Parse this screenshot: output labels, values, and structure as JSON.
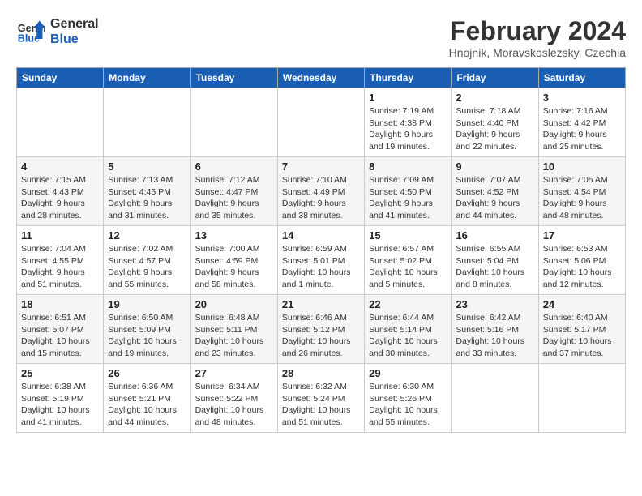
{
  "header": {
    "logo_line1": "General",
    "logo_line2": "Blue",
    "month_year": "February 2024",
    "location": "Hnojnik, Moravskoslezsky, Czechia"
  },
  "weekdays": [
    "Sunday",
    "Monday",
    "Tuesday",
    "Wednesday",
    "Thursday",
    "Friday",
    "Saturday"
  ],
  "weeks": [
    [
      {
        "day": "",
        "info": ""
      },
      {
        "day": "",
        "info": ""
      },
      {
        "day": "",
        "info": ""
      },
      {
        "day": "",
        "info": ""
      },
      {
        "day": "1",
        "info": "Sunrise: 7:19 AM\nSunset: 4:38 PM\nDaylight: 9 hours\nand 19 minutes."
      },
      {
        "day": "2",
        "info": "Sunrise: 7:18 AM\nSunset: 4:40 PM\nDaylight: 9 hours\nand 22 minutes."
      },
      {
        "day": "3",
        "info": "Sunrise: 7:16 AM\nSunset: 4:42 PM\nDaylight: 9 hours\nand 25 minutes."
      }
    ],
    [
      {
        "day": "4",
        "info": "Sunrise: 7:15 AM\nSunset: 4:43 PM\nDaylight: 9 hours\nand 28 minutes."
      },
      {
        "day": "5",
        "info": "Sunrise: 7:13 AM\nSunset: 4:45 PM\nDaylight: 9 hours\nand 31 minutes."
      },
      {
        "day": "6",
        "info": "Sunrise: 7:12 AM\nSunset: 4:47 PM\nDaylight: 9 hours\nand 35 minutes."
      },
      {
        "day": "7",
        "info": "Sunrise: 7:10 AM\nSunset: 4:49 PM\nDaylight: 9 hours\nand 38 minutes."
      },
      {
        "day": "8",
        "info": "Sunrise: 7:09 AM\nSunset: 4:50 PM\nDaylight: 9 hours\nand 41 minutes."
      },
      {
        "day": "9",
        "info": "Sunrise: 7:07 AM\nSunset: 4:52 PM\nDaylight: 9 hours\nand 44 minutes."
      },
      {
        "day": "10",
        "info": "Sunrise: 7:05 AM\nSunset: 4:54 PM\nDaylight: 9 hours\nand 48 minutes."
      }
    ],
    [
      {
        "day": "11",
        "info": "Sunrise: 7:04 AM\nSunset: 4:55 PM\nDaylight: 9 hours\nand 51 minutes."
      },
      {
        "day": "12",
        "info": "Sunrise: 7:02 AM\nSunset: 4:57 PM\nDaylight: 9 hours\nand 55 minutes."
      },
      {
        "day": "13",
        "info": "Sunrise: 7:00 AM\nSunset: 4:59 PM\nDaylight: 9 hours\nand 58 minutes."
      },
      {
        "day": "14",
        "info": "Sunrise: 6:59 AM\nSunset: 5:01 PM\nDaylight: 10 hours\nand 1 minute."
      },
      {
        "day": "15",
        "info": "Sunrise: 6:57 AM\nSunset: 5:02 PM\nDaylight: 10 hours\nand 5 minutes."
      },
      {
        "day": "16",
        "info": "Sunrise: 6:55 AM\nSunset: 5:04 PM\nDaylight: 10 hours\nand 8 minutes."
      },
      {
        "day": "17",
        "info": "Sunrise: 6:53 AM\nSunset: 5:06 PM\nDaylight: 10 hours\nand 12 minutes."
      }
    ],
    [
      {
        "day": "18",
        "info": "Sunrise: 6:51 AM\nSunset: 5:07 PM\nDaylight: 10 hours\nand 15 minutes."
      },
      {
        "day": "19",
        "info": "Sunrise: 6:50 AM\nSunset: 5:09 PM\nDaylight: 10 hours\nand 19 minutes."
      },
      {
        "day": "20",
        "info": "Sunrise: 6:48 AM\nSunset: 5:11 PM\nDaylight: 10 hours\nand 23 minutes."
      },
      {
        "day": "21",
        "info": "Sunrise: 6:46 AM\nSunset: 5:12 PM\nDaylight: 10 hours\nand 26 minutes."
      },
      {
        "day": "22",
        "info": "Sunrise: 6:44 AM\nSunset: 5:14 PM\nDaylight: 10 hours\nand 30 minutes."
      },
      {
        "day": "23",
        "info": "Sunrise: 6:42 AM\nSunset: 5:16 PM\nDaylight: 10 hours\nand 33 minutes."
      },
      {
        "day": "24",
        "info": "Sunrise: 6:40 AM\nSunset: 5:17 PM\nDaylight: 10 hours\nand 37 minutes."
      }
    ],
    [
      {
        "day": "25",
        "info": "Sunrise: 6:38 AM\nSunset: 5:19 PM\nDaylight: 10 hours\nand 41 minutes."
      },
      {
        "day": "26",
        "info": "Sunrise: 6:36 AM\nSunset: 5:21 PM\nDaylight: 10 hours\nand 44 minutes."
      },
      {
        "day": "27",
        "info": "Sunrise: 6:34 AM\nSunset: 5:22 PM\nDaylight: 10 hours\nand 48 minutes."
      },
      {
        "day": "28",
        "info": "Sunrise: 6:32 AM\nSunset: 5:24 PM\nDaylight: 10 hours\nand 51 minutes."
      },
      {
        "day": "29",
        "info": "Sunrise: 6:30 AM\nSunset: 5:26 PM\nDaylight: 10 hours\nand 55 minutes."
      },
      {
        "day": "",
        "info": ""
      },
      {
        "day": "",
        "info": ""
      }
    ]
  ]
}
